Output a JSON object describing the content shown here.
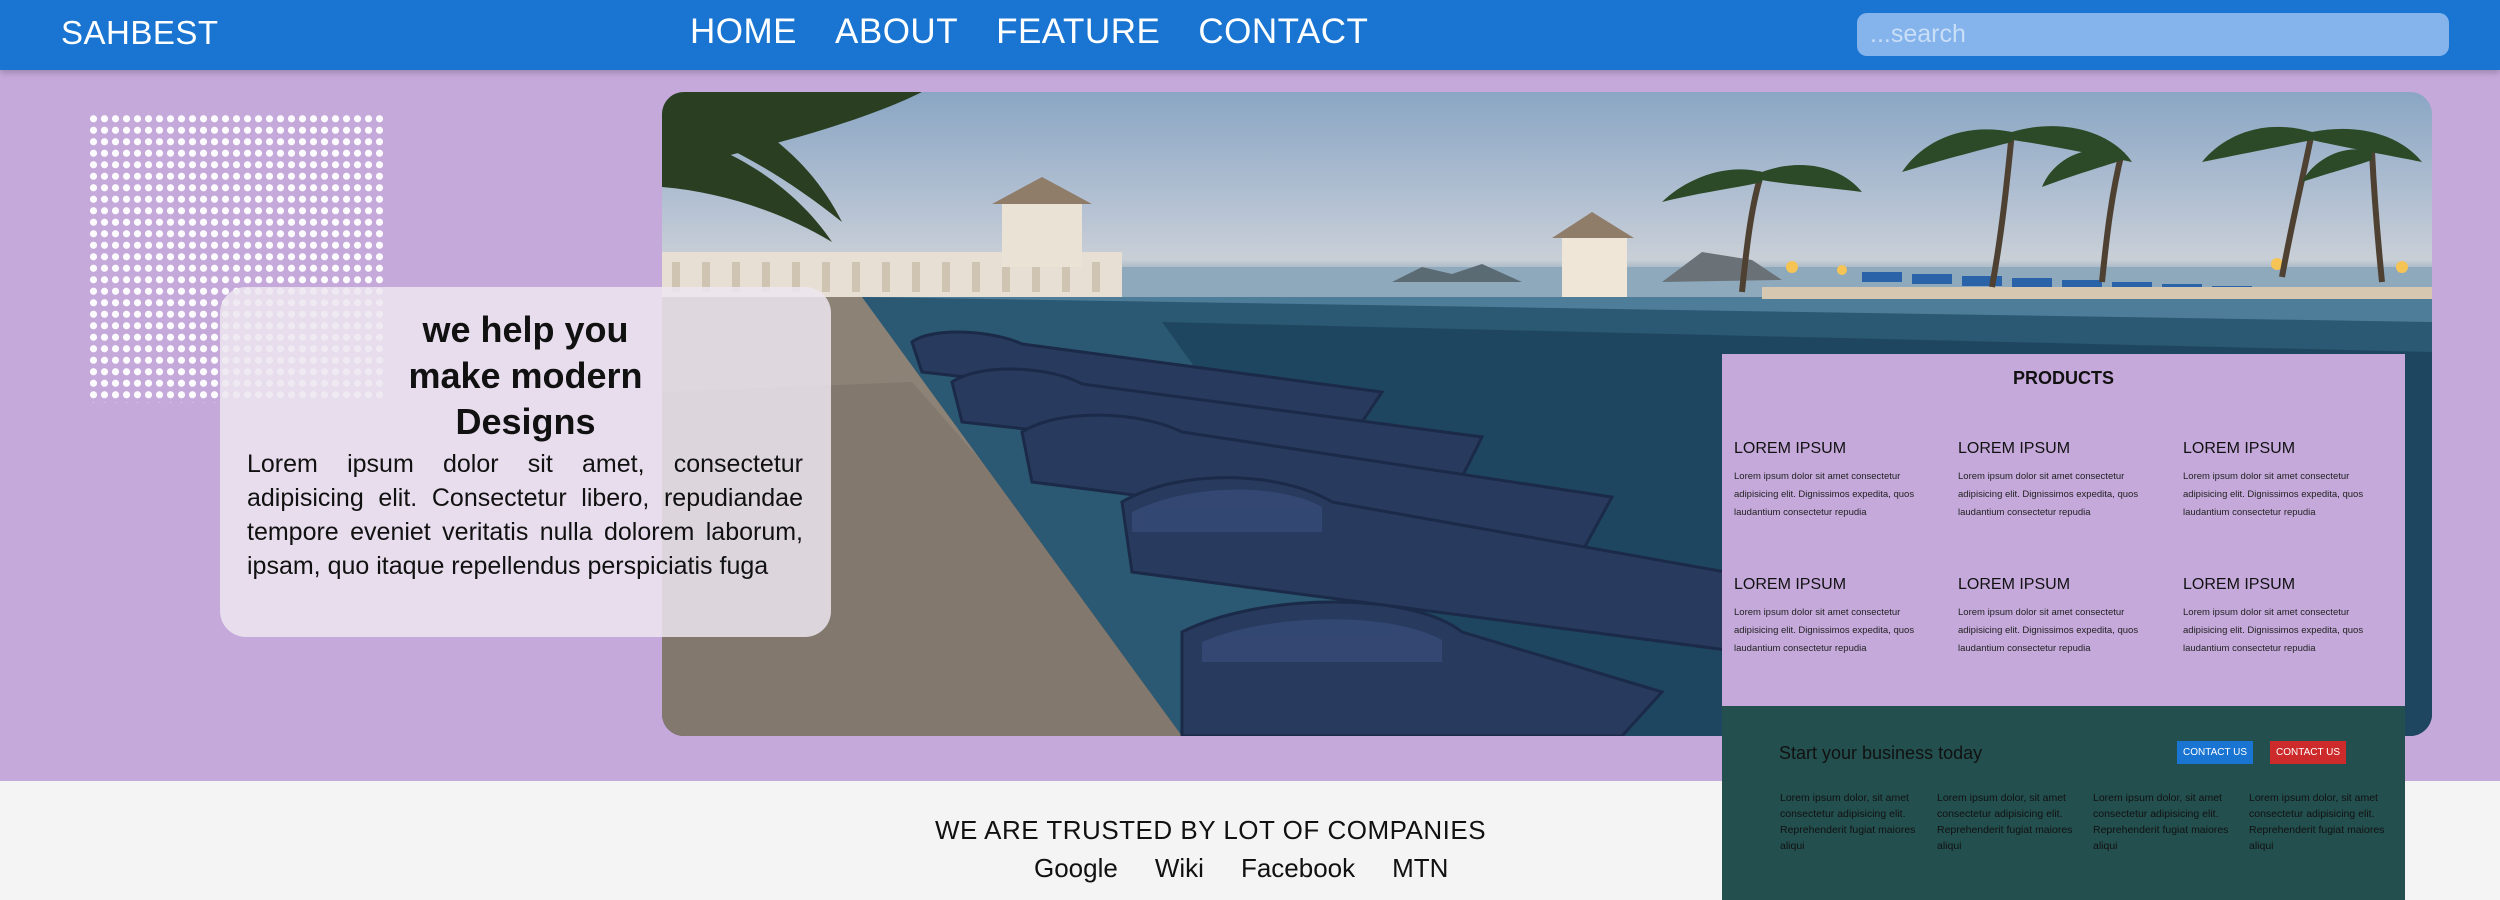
{
  "navbar": {
    "brand": "SAHBEST",
    "links": [
      "HOME",
      "ABOUT",
      "FEATURE",
      "CONTACT"
    ],
    "search_placeholder": "...search"
  },
  "hero": {
    "title_lines": [
      "we help you",
      "make modern",
      "Designs"
    ],
    "text": "Lorem ipsum dolor sit amet, consectetur adipisicing elit. Consectetur libero, repudiandae tempore eveniet veritatis nulla dolorem laborum, ipsam, quo itaque repellendus perspiciatis fuga"
  },
  "products": {
    "title": "PRODUCTS",
    "items": [
      {
        "title": "LOREM IPSUM",
        "text": "Lorem ipsum dolor sit amet consectetur adipisicing elit. Dignissimos expedita, quos laudantium consectetur repudia"
      },
      {
        "title": "LOREM IPSUM",
        "text": "Lorem ipsum dolor sit amet consectetur adipisicing elit. Dignissimos expedita, quos laudantium consectetur repudia"
      },
      {
        "title": "LOREM IPSUM",
        "text": "Lorem ipsum dolor sit amet consectetur adipisicing elit. Dignissimos expedita, quos laudantium consectetur repudia"
      },
      {
        "title": "LOREM IPSUM",
        "text": "Lorem ipsum dolor sit amet consectetur adipisicing elit. Dignissimos expedita, quos laudantium consectetur repudia"
      },
      {
        "title": "LOREM IPSUM",
        "text": "Lorem ipsum dolor sit amet consectetur adipisicing elit. Dignissimos expedita, quos laudantium consectetur repudia"
      },
      {
        "title": "LOREM IPSUM",
        "text": "Lorem ipsum dolor sit amet consectetur adipisicing elit. Dignissimos expedita, quos laudantium consectetur repudia"
      }
    ]
  },
  "business": {
    "title": "Start your business today",
    "button_primary": "CONTACT US",
    "button_secondary": "CONTACT US",
    "columns": [
      "Lorem ipsum dolor, sit amet consectetur adipisicing elit. Reprehenderit fugiat maiores aliqui",
      "Lorem ipsum dolor, sit amet consectetur adipisicing elit. Reprehenderit fugiat maiores aliqui",
      "Lorem ipsum dolor, sit amet consectetur adipisicing elit. Reprehenderit fugiat maiores aliqui",
      "Lorem ipsum dolor, sit amet consectetur adipisicing elit. Reprehenderit fugiat maiores aliqui"
    ]
  },
  "trusted": {
    "title": "WE ARE TRUSTED BY LOT OF COMPANIES",
    "companies": [
      "Google",
      "Wiki",
      "Facebook",
      "MTN"
    ]
  },
  "colors": {
    "navbar": "#1a75d2",
    "background": "#c5a9db",
    "business_panel": "#234f4e",
    "button_blue": "#1a75d2",
    "button_red": "#cd2b2b",
    "trusted_bg": "#f3f4f3"
  }
}
